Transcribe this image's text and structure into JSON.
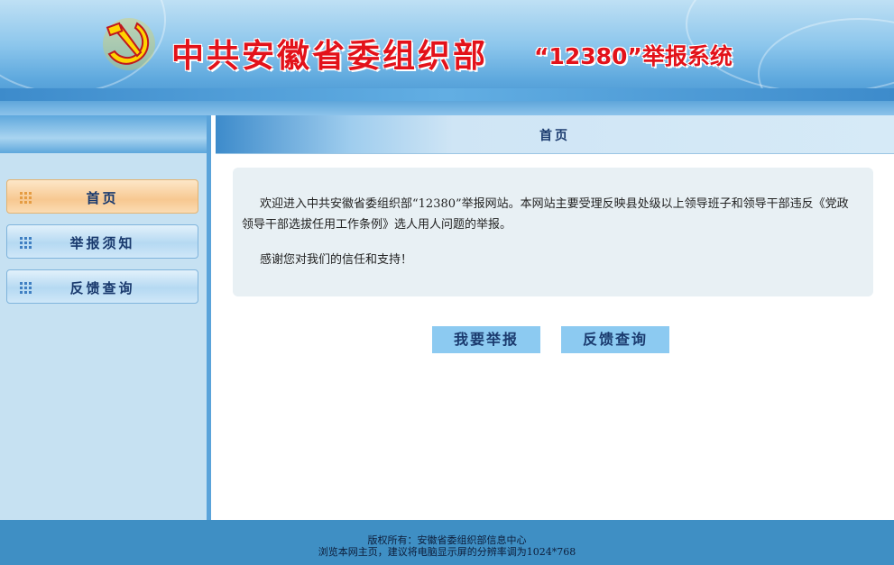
{
  "header": {
    "title": "中共安徽省委组织部",
    "subtitle": "“12380”举报系统"
  },
  "sidebar": {
    "items": [
      {
        "label": "首页",
        "active": true
      },
      {
        "label": "举报须知",
        "active": false
      },
      {
        "label": "反馈查询",
        "active": false
      }
    ]
  },
  "main": {
    "heading": "首页",
    "welcome_paragraph_1": "欢迎进入中共安徽省委组织部“12380”举报网站。本网站主要受理反映县处级以上领导班子和领导干部违反《党政领导干部选拔任用工作条例》选人用人问题的举报。",
    "welcome_paragraph_2": "感谢您对我们的信任和支持！",
    "actions": {
      "report_label": "我要举报",
      "feedback_label": "反馈查询"
    }
  },
  "footer": {
    "line1": "版权所有：安徽省委组织部信息中心",
    "line2": "浏览本网主页，建议将电脑显示屏的分辨率调为1024*768"
  },
  "colors": {
    "title_red": "#e3121a",
    "nav_text": "#1a3a6e",
    "active_nav": "#f7c891",
    "button_bg": "#8ccaf1",
    "footer_bg": "#3f8fc4"
  }
}
